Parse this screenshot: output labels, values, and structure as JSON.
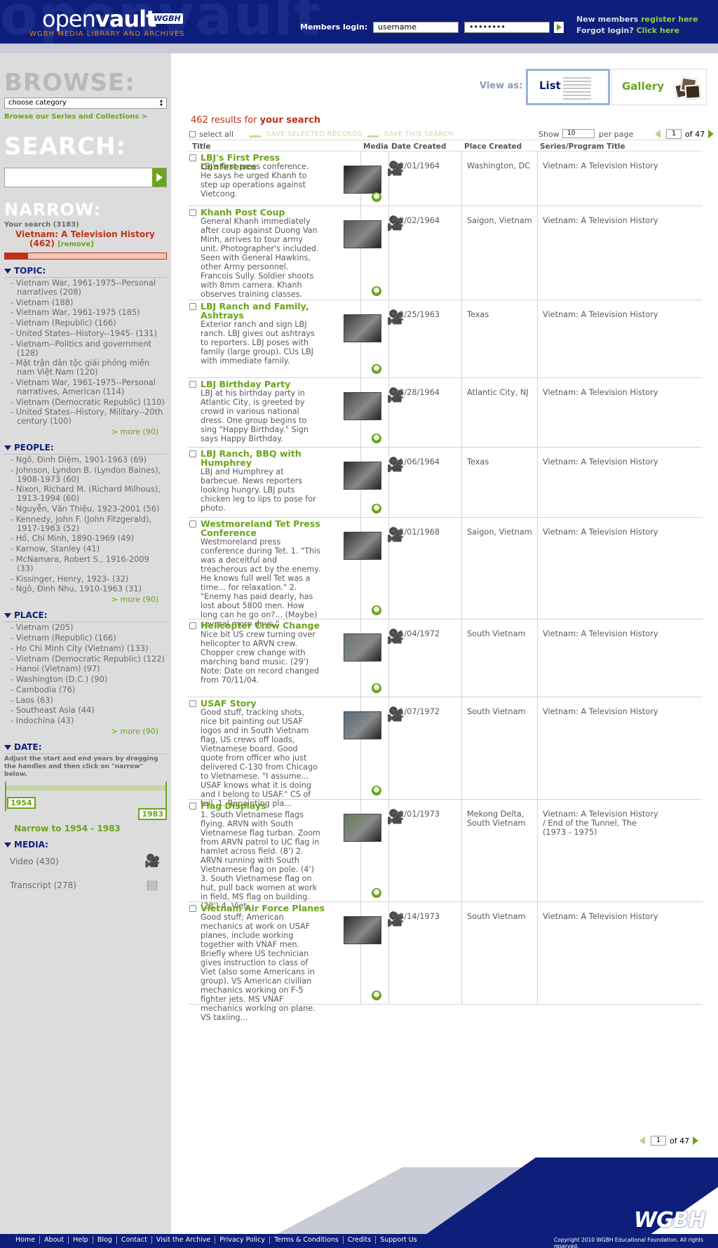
{
  "header": {
    "ghost_text": "openvault",
    "logo_open": "open",
    "logo_vault": "vault",
    "logo_badge": "WGBH",
    "logo_sub": "WGBH   MEDIA LIBRARY AND ARCHIVES",
    "members_login_label": "Members login:",
    "username_value": "username",
    "password_value": "••••••••",
    "new_members_text": "New members",
    "register_link": "register here",
    "forgot_text": "Forgot login?",
    "click_here": "Click here"
  },
  "sidebar": {
    "browse_heading": "BROWSE:",
    "category_select": "choose category",
    "browse_series_link": "Browse our Series and Collections >",
    "search_heading": "SEARCH:",
    "search_value": "",
    "narrow_heading": "NARROW:",
    "your_search": "Your search (3183)",
    "current_facet": "Vietnam: A Television History",
    "current_count": "(462)",
    "remove_link": "[remove]",
    "meter_fraction": 0.145,
    "topic": {
      "title": "TOPIC:",
      "items": [
        "Vietnam War, 1961-1975--Personal narratives (208)",
        "Vietnam (188)",
        "Vietnam War, 1961-1975 (185)",
        "Vietnam (Republic) (166)",
        "United States--History--1945- (131)",
        "Vietnam--Politics and government (128)",
        "Mặt trận dân tộc giải phóng miền nam Việt Nam (120)",
        "Vietnam War, 1961-1975--Personal narratives, American (114)",
        "Vietnam (Democratic Republic) (110)",
        "United States--History, Military--20th century (100)"
      ],
      "more": "> more (90)"
    },
    "people": {
      "title": "PEOPLE:",
      "items": [
        "Ngô, Đình Diệm, 1901-1963 (69)",
        "Johnson, Lyndon B. (Lyndon Baines), 1908-1973 (60)",
        "Nixon, Richard M. (Richard Milhous), 1913-1994 (60)",
        "Nguyễn, Văn Thiệu, 1923-2001 (56)",
        "Kennedy, John F. (John Fitzgerald), 1917-1963 (52)",
        "Hồ, Chí Minh, 1890-1969 (49)",
        "Karnow, Stanley (41)",
        "McNamara, Robert S., 1916-2009 (33)",
        "Kissinger, Henry, 1923- (32)",
        "Ngô, Đình Nhu, 1910-1963 (31)"
      ],
      "more": "> more (90)"
    },
    "place": {
      "title": "PLACE:",
      "items": [
        "Vietnam (205)",
        "Vietnam (Republic) (166)",
        "Ho Chi Minh City (Vietnam) (133)",
        "Vietnam (Democratic Republic) (122)",
        "Hanoi (Vietnam) (97)",
        "Washington (D.C.) (90)",
        "Cambodia (76)",
        "Laos (63)",
        "Southeast Asia (44)",
        "Indochina (43)"
      ],
      "more": "> more (90)"
    },
    "date": {
      "title": "DATE:",
      "help": "Adjust the start and end years by dragging the handles and then click on \"narrow\" below.",
      "start": "1954",
      "end": "1983",
      "narrow_link": "Narrow to 1954 - 1983"
    },
    "media": {
      "title": "MEDIA:",
      "items": [
        {
          "label": "Video (430)",
          "icon": "film-camera-icon"
        },
        {
          "label": "Transcript (278)",
          "icon": "document-icon"
        }
      ]
    }
  },
  "main": {
    "view_as": "View as:",
    "view_list": "List",
    "view_gallery": "Gallery",
    "results_count": "462 results for",
    "results_query": "your search",
    "select_all": "select all",
    "save_records": "SAVE SELECTED RECORDS",
    "save_search": "SAVE THIS SEARCH",
    "show_label": "Show",
    "show_value": "10",
    "per_page": "per page",
    "page_value": "1",
    "page_of": "of 47",
    "columns": [
      "Title",
      "Media",
      "Date Created",
      "Place Created",
      "Series/Program Title"
    ],
    "records": [
      {
        "title": "LBJ's First Press Conference",
        "desc": "LBJ's first press conference. He says he urged Khanh to step up operations against Vietcong.",
        "date": "02/01/1964",
        "place": "Washington, DC",
        "series": "Vietnam: A Television History"
      },
      {
        "title": "Khanh Post Coup",
        "desc": "General Khanh immediately after coup against Duong Van Minh, arrives to tour army unit. Photographer's included. Seen with General Hawkins, other Army personnel. Francois Sully. Soldier shoots with 8mm camera. Khanh observes training classes.",
        "date": "02/02/1964",
        "place": "Saigon, Vietnam",
        "series": "Vietnam: A Television History"
      },
      {
        "title": "LBJ Ranch and Family, Ashtrays",
        "desc": "Exterior ranch and sign LBJ ranch. LBJ gives out ashtrays to reporters. LBJ poses with family (large group). CUs LBJ with immediate family.",
        "date": "12/25/1963",
        "place": "Texas",
        "series": "Vietnam: A Television History"
      },
      {
        "title": "LBJ Birthday Party",
        "desc": "LBJ at his birthday party in Atlantic City, is greeted by crowd in various national dress. One group begins to sing \"Happy Birthday.\" Sign says Happy Birthday.",
        "date": "08/28/1964",
        "place": "Atlantic City, NJ",
        "series": "Vietnam: A Television History"
      },
      {
        "title": "LBJ Ranch, BBQ with Humphrey",
        "desc": "LBJ and Humphrey at barbecue. News reporters looking hungry. LBJ puts chicken leg to lips to pose for photo.",
        "date": "11/06/1964",
        "place": "Texas",
        "series": "Vietnam: A Television History"
      },
      {
        "title": "Westmoreland Tet Press Conference",
        "desc": "Westmoreland press conference during Tet. 1. \"This was a deceitful and treacherous act by the enemy. He knows full well Tet was a time... for relaxation.\" 2. \"Enemy has paid dearly, has lost about 5800 men. How long can he go on?... (Maybe) several more days.\"",
        "date": "02/01/1968",
        "place": "Saigon, Vietnam",
        "series": "Vietnam: A Television History"
      },
      {
        "title": "Helicopter Crew Change",
        "desc": "Nice bit US crew turning over helicopter to ARVN crew. Chopper crew change with marching band music. (29') Note: Date on record changed from 70/11/04.",
        "date": "11/04/1972",
        "place": "South Vietnam",
        "series": "Vietnam: A Television History"
      },
      {
        "title": "USAF Story",
        "desc": "Good stuff, tracking shots, nice bit painting out USAF logos and in South Vietnam flag, US crews off loads, Vietnamese board. Good quote from officer who just delivered C-130 from Chicago to Vietnamese. \"I assume... USAF knows what it is doing and I belong to USAF.\" CS of tail. 1. Repainting pla...",
        "date": "11/07/1972",
        "place": "South Vietnam",
        "series": "Vietnam: A Television History"
      },
      {
        "title": "Flag Displays",
        "desc": "1. South Vietnamese flags flying. ARVN with South Vietnamese flag turban. Zoom from ARVN patrol to UC flag in hamlet across field. (8') 2. ARVN running with South Vietnamese flag on pole. (4') 3. South Vietnamese flag on hut, pull back women at work in field, MS flag on building. (28') 4. Viet...",
        "date": "02/01/1973",
        "place": "Mekong Delta, South Vietnam",
        "series": "Vietnam: A Television History / End of the Tunnel, The (1973 - 1975)"
      },
      {
        "title": "Vietnam Air Force Planes",
        "desc": "Good stuff; American mechanics at work on USAF planes, include working together with VNAF men. Briefly where US technician gives instruction to class of Viet (also some Americans in group). VS American civilian mechanics working on F-5 fighter jets. MS VNAF mechanics working on plane. VS taxiing...",
        "date": "03/14/1973",
        "place": "South Vietnam",
        "series": "Vietnam: A Television History"
      }
    ]
  },
  "footer": {
    "links": [
      "Home",
      "About",
      "Help",
      "Blog",
      "Contact",
      "Visit the Archive",
      "Privacy Policy",
      "Terms & Conditions",
      "Credits",
      "Support Us"
    ],
    "logo": "WGBH",
    "copyright": "Copyright 2010 WGBH Educational Foundation. All rights reserved."
  }
}
